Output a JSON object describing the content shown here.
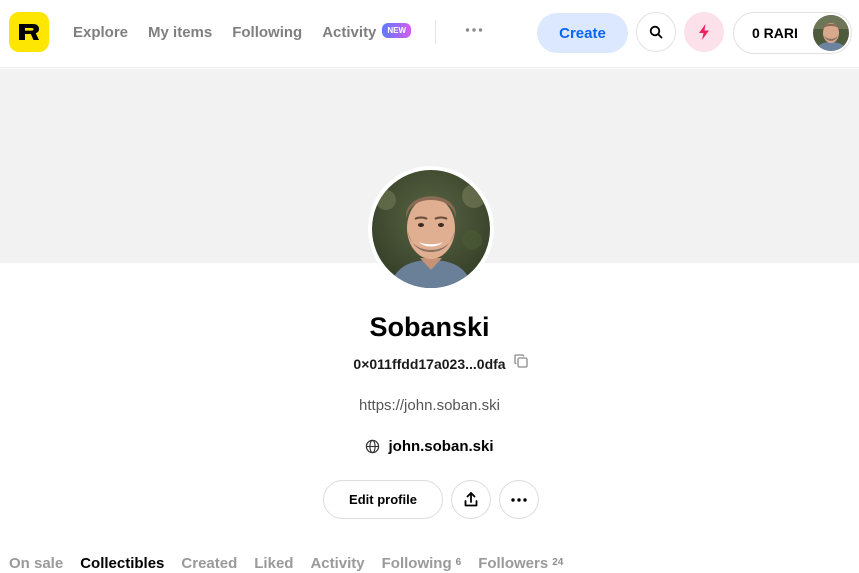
{
  "header": {
    "logo_alt": "R",
    "nav": [
      {
        "label": "Explore"
      },
      {
        "label": "My items"
      },
      {
        "label": "Following"
      },
      {
        "label": "Activity",
        "badge": "NEW"
      }
    ],
    "create_label": "Create",
    "wallet_label": "0 RARI"
  },
  "profile": {
    "name": "Sobanski",
    "address": "0×011ffdd17a023...0dfa",
    "bio": "https://john.soban.ski",
    "website": "john.soban.ski",
    "edit_label": "Edit profile"
  },
  "tabs": [
    {
      "label": "On sale",
      "count": ""
    },
    {
      "label": "Collectibles",
      "count": "",
      "active": true
    },
    {
      "label": "Created",
      "count": ""
    },
    {
      "label": "Liked",
      "count": ""
    },
    {
      "label": "Activity",
      "count": ""
    },
    {
      "label": "Following",
      "count": "6"
    },
    {
      "label": "Followers",
      "count": "24"
    }
  ],
  "colors": {
    "logo_bg": "#fee603",
    "create_bg": "#dbe8ff",
    "create_text": "#0b65f4",
    "bolt": "#f0205c",
    "cover": "#f2f2f2"
  },
  "icons": [
    "search-icon",
    "bolt-icon",
    "copy-icon",
    "globe-icon",
    "share-icon",
    "more-icon"
  ]
}
